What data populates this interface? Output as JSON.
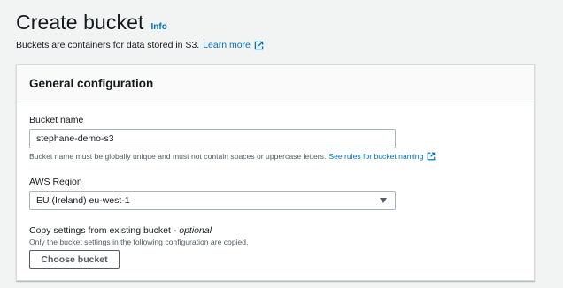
{
  "header": {
    "title": "Create bucket",
    "info_label": "Info",
    "subtitle": "Buckets are containers for data stored in S3.",
    "learn_more": "Learn more"
  },
  "general_config": {
    "title": "General configuration",
    "bucket_name": {
      "label": "Bucket name",
      "value": "stephane-demo-s3",
      "constraint": "Bucket name must be globally unique and must not contain spaces or uppercase letters.",
      "rules_link": "See rules for bucket naming"
    },
    "region": {
      "label": "AWS Region",
      "selected": "EU (Ireland) eu-west-1"
    },
    "copy_settings": {
      "label": "Copy settings from existing bucket -",
      "optional": "optional",
      "description": "Only the bucket settings in the following configuration are copied.",
      "button_label": "Choose bucket"
    }
  },
  "colors": {
    "link": "#0073bb",
    "text": "#16191f",
    "muted": "#545b64",
    "background": "#f2f3f3",
    "panel_header": "#fafafa",
    "border": "#aab7b8"
  },
  "icons": {
    "external": "external-link-icon",
    "caret": "caret-down-icon"
  }
}
